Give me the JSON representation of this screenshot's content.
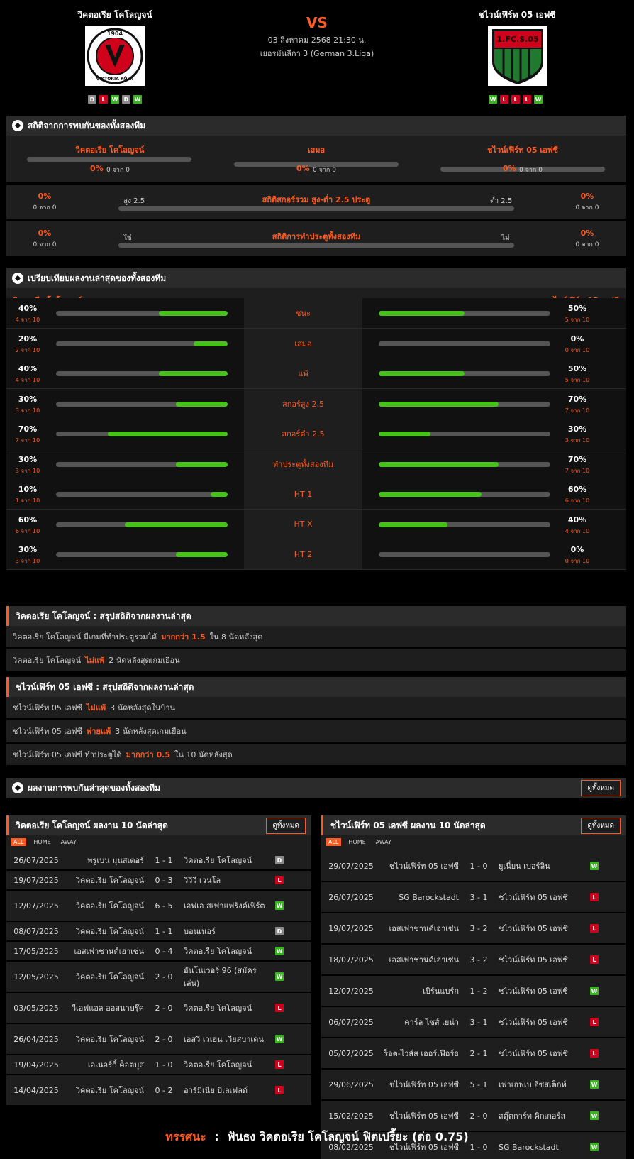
{
  "header": {
    "home_team": "วิคตอเรีย โคโลญจน์",
    "away_team": "ชไวน์เฟิร์ท 05 เอฟซี",
    "vs": "VS",
    "date": "03 สิงหาคม 2568 21:30 น.",
    "league": "เยอรมันลีกา 3 (German 3.Liga)",
    "home_logo_year": "1904",
    "home_logo_text": "VIKTORIA KÖLN",
    "away_logo_text": "1.FC.S.05",
    "home_form": [
      "D",
      "L",
      "W",
      "D",
      "W"
    ],
    "away_form": [
      "W",
      "L",
      "L",
      "L",
      "W"
    ]
  },
  "h2h": {
    "title": "สถิติจากการพบกันของทั้งสองทีม",
    "cols": [
      {
        "label": "วิคตอเรีย โคโลญจน์",
        "pct": "0%",
        "sub": "0 จาก 0"
      },
      {
        "label": "เสมอ",
        "pct": "0%",
        "sub": "0 จาก 0"
      },
      {
        "label": "ชไวน์เฟิร์ท 05 เอฟซี",
        "pct": "0%",
        "sub": "0 จาก 0"
      }
    ],
    "ou": {
      "title": "สถิติสกอร์รวม สูง-ต่ำ 2.5 ประตู",
      "left_label": "สูง 2.5",
      "right_label": "ต่ำ 2.5",
      "left_pct": "0%",
      "left_sub": "0 จาก 0",
      "right_pct": "0%",
      "right_sub": "0 จาก 0"
    },
    "btts": {
      "title": "สถิติการทำประตูทั้งสองทีม",
      "left_label": "ใช่",
      "right_label": "ไม่",
      "left_pct": "0%",
      "left_sub": "0 จาก 0",
      "right_pct": "0%",
      "right_sub": "0 จาก 0"
    }
  },
  "compare": {
    "title": "เปรียบเทียบผลงานล่าสุดของทั้งสองทีม",
    "home_label": "วิคตอเรีย โคโลญจน์",
    "away_label": "ชไวน์เฟิร์ท 05 เอฟซี",
    "rows": [
      {
        "label": "ชนะ",
        "home_pct": "40%",
        "home_sub": "4 จาก 10",
        "home_val": 40,
        "away_pct": "50%",
        "away_sub": "5 จาก 10",
        "away_val": 50
      },
      {
        "label": "เสมอ",
        "home_pct": "20%",
        "home_sub": "2 จาก 10",
        "home_val": 20,
        "away_pct": "0%",
        "away_sub": "0 จาก 10",
        "away_val": 0
      },
      {
        "label": "แพ้",
        "home_pct": "40%",
        "home_sub": "4 จาก 10",
        "home_val": 40,
        "away_pct": "50%",
        "away_sub": "5 จาก 10",
        "away_val": 50
      },
      {
        "label": "สกอร์สูง 2.5",
        "home_pct": "30%",
        "home_sub": "3 จาก 10",
        "home_val": 30,
        "away_pct": "70%",
        "away_sub": "7 จาก 10",
        "away_val": 70
      },
      {
        "label": "สกอร์ต่ำ 2.5",
        "home_pct": "70%",
        "home_sub": "7 จาก 10",
        "home_val": 70,
        "away_pct": "30%",
        "away_sub": "3 จาก 10",
        "away_val": 30
      },
      {
        "label": "ทำประตูทั้งสองทีม",
        "home_pct": "30%",
        "home_sub": "3 จาก 10",
        "home_val": 30,
        "away_pct": "70%",
        "away_sub": "7 จาก 10",
        "away_val": 70
      },
      {
        "label": "HT 1",
        "home_pct": "10%",
        "home_sub": "1 จาก 10",
        "home_val": 10,
        "away_pct": "60%",
        "away_sub": "6 จาก 10",
        "away_val": 60
      },
      {
        "label": "HT X",
        "home_pct": "60%",
        "home_sub": "6 จาก 10",
        "home_val": 60,
        "away_pct": "40%",
        "away_sub": "4 จาก 10",
        "away_val": 40
      },
      {
        "label": "HT 2",
        "home_pct": "30%",
        "home_sub": "3 จาก 10",
        "home_val": 30,
        "away_pct": "0%",
        "away_sub": "0 จาก 10",
        "away_val": 0
      }
    ]
  },
  "home_summary": {
    "title": "วิคตอเรีย โคโลญจน์ : สรุปสถิติจากผลงานล่าสุด",
    "lines": [
      {
        "a": "วิคตอเรีย โคโลญจน์ มีเกมที่ทำประตูรวมได้",
        "h": "มากกว่า 1.5",
        "b": "ใน 8 นัดหลังสุด"
      },
      {
        "a": "วิคตอเรีย โคโลญจน์",
        "h": "ไม่แพ้",
        "b": "2 นัดหลังสุดเกมเยือน"
      }
    ]
  },
  "away_summary": {
    "title": "ชไวน์เฟิร์ท 05 เอฟซี : สรุปสถิติจากผลงานล่าสุด",
    "lines": [
      {
        "a": "ชไวน์เฟิร์ท 05 เอฟซี",
        "h": "ไม่แพ้",
        "b": "3 นัดหลังสุดในบ้าน"
      },
      {
        "a": "ชไวน์เฟิร์ท 05 เอฟซี",
        "h": "พ่ายแพ้",
        "b": "3 นัดหลังสุดเกมเยือน"
      },
      {
        "a": "ชไวน์เฟิร์ท 05 เอฟซี ทำประตูได้",
        "h": "มากกว่า 0.5",
        "b": "ใน 10 นัดหลังสุด"
      }
    ]
  },
  "recent_h2h": {
    "title": "ผลงานการพบกันล่าสุดของทั้งสองทีม",
    "button": "ดูทั้งหมด"
  },
  "home_list": {
    "title": "วิคตอเรีย โคโลญจน์ ผลงาน 10 นัดล่าสุด",
    "button": "ดูทั้งหมด",
    "filters": [
      "ALL",
      "HOME",
      "AWAY"
    ],
    "matches": [
      {
        "date": "26/07/2025",
        "home": "พรูเบน มุนสเตอร์",
        "score": "1 - 1",
        "away": "วิคตอเรีย โคโลญจน์",
        "res": "D"
      },
      {
        "date": "19/07/2025",
        "home": "วิคตอเรีย โคโลญจน์",
        "score": "0 - 3",
        "away": "วีวีวี เวนโล",
        "res": "L"
      },
      {
        "date": "12/07/2025",
        "home": "วิคตอเรีย โคโลญจน์",
        "score": "6 - 5",
        "away": "เอฟเอ สเฟาแฟร้งค์เฟิร์ต",
        "res": "W"
      },
      {
        "date": "08/07/2025",
        "home": "วิคตอเรีย โคโลญจน์",
        "score": "1 - 1",
        "away": "บอนเนอร์",
        "res": "D"
      },
      {
        "date": "17/05/2025",
        "home": "เอสเฟาชานด์เฮาเซ่น",
        "score": "0 - 4",
        "away": "วิคตอเรีย โคโลญจน์",
        "res": "W"
      },
      {
        "date": "12/05/2025",
        "home": "วิคตอเรีย โคโลญจน์",
        "score": "2 - 0",
        "away": "ฮันโนเวอร์ 96 (สมัครเล่น)",
        "res": "W"
      },
      {
        "date": "03/05/2025",
        "home": "วีเอฟแอล ออสนาบรุ๊ค",
        "score": "2 - 0",
        "away": "วิคตอเรีย โคโลญจน์",
        "res": "L"
      },
      {
        "date": "26/04/2025",
        "home": "วิคตอเรีย โคโลญจน์",
        "score": "2 - 0",
        "away": "เอสวี เวเฮน เวียสบาเดน",
        "res": "W"
      },
      {
        "date": "19/04/2025",
        "home": "เอเนอร์กี้ ค็อตบุส",
        "score": "1 - 0",
        "away": "วิคตอเรีย โคโลญจน์",
        "res": "L"
      },
      {
        "date": "14/04/2025",
        "home": "วิคตอเรีย โคโลญจน์",
        "score": "0 - 2",
        "away": "อาร์มีเนีย บีเลเฟลด์",
        "res": "L"
      }
    ]
  },
  "away_list": {
    "title": "ชไวน์เฟิร์ท 05 เอฟซี ผลงาน 10 นัดล่าสุด",
    "button": "ดูทั้งหมด",
    "filters": [
      "ALL",
      "HOME",
      "AWAY"
    ],
    "matches": [
      {
        "date": "29/07/2025",
        "home": "ชไวน์เฟิร์ท 05 เอฟซี",
        "score": "1 - 0",
        "away": "ยูเนี่ยน เบอร์ลิน",
        "res": "W"
      },
      {
        "date": "26/07/2025",
        "home": "SG Barockstadt",
        "score": "3 - 1",
        "away": "ชไวน์เฟิร์ท 05 เอฟซี",
        "res": "L"
      },
      {
        "date": "19/07/2025",
        "home": "เอสเฟาชานด์เฮาเซ่น",
        "score": "3 - 2",
        "away": "ชไวน์เฟิร์ท 05 เอฟซี",
        "res": "L"
      },
      {
        "date": "18/07/2025",
        "home": "เอสเฟาชานด์เฮาเซ่น",
        "score": "3 - 2",
        "away": "ชไวน์เฟิร์ท 05 เอฟซี",
        "res": "L"
      },
      {
        "date": "12/07/2025",
        "home": "เบิร์นแบร์ก",
        "score": "1 - 2",
        "away": "ชไวน์เฟิร์ท 05 เอฟซี",
        "res": "W"
      },
      {
        "date": "06/07/2025",
        "home": "คาร์ล ไซส์ เยน่า",
        "score": "3 - 1",
        "away": "ชไวน์เฟิร์ท 05 เอฟซี",
        "res": "L"
      },
      {
        "date": "05/07/2025",
        "home": "ร็อต-ไวส์ส เออร์เฟือร์ธ",
        "score": "2 - 1",
        "away": "ชไวน์เฟิร์ท 05 เอฟซี",
        "res": "L"
      },
      {
        "date": "29/06/2025",
        "home": "ชไวน์เฟิร์ท 05 เอฟซี",
        "score": "5 - 1",
        "away": "เฟาเอฟเบ อิซสเต็กท์",
        "res": "W"
      },
      {
        "date": "15/02/2025",
        "home": "ชไวน์เฟิร์ท 05 เอฟซี",
        "score": "2 - 0",
        "away": "สตุ๊ตการ์ท คิกเกอร์ส",
        "res": "W"
      },
      {
        "date": "08/02/2025",
        "home": "ชไวน์เฟิร์ท 05 เอฟซี",
        "score": "1 - 0",
        "away": "SG Barockstadt",
        "res": "W"
      }
    ]
  },
  "footer": {
    "label": "ทรรศนะ",
    "sep": ":",
    "text": "ฟันธง วิคตอเรีย โคโลญจน์ ฟิตเปรี้ยะ (ต่อ 0.75)"
  }
}
